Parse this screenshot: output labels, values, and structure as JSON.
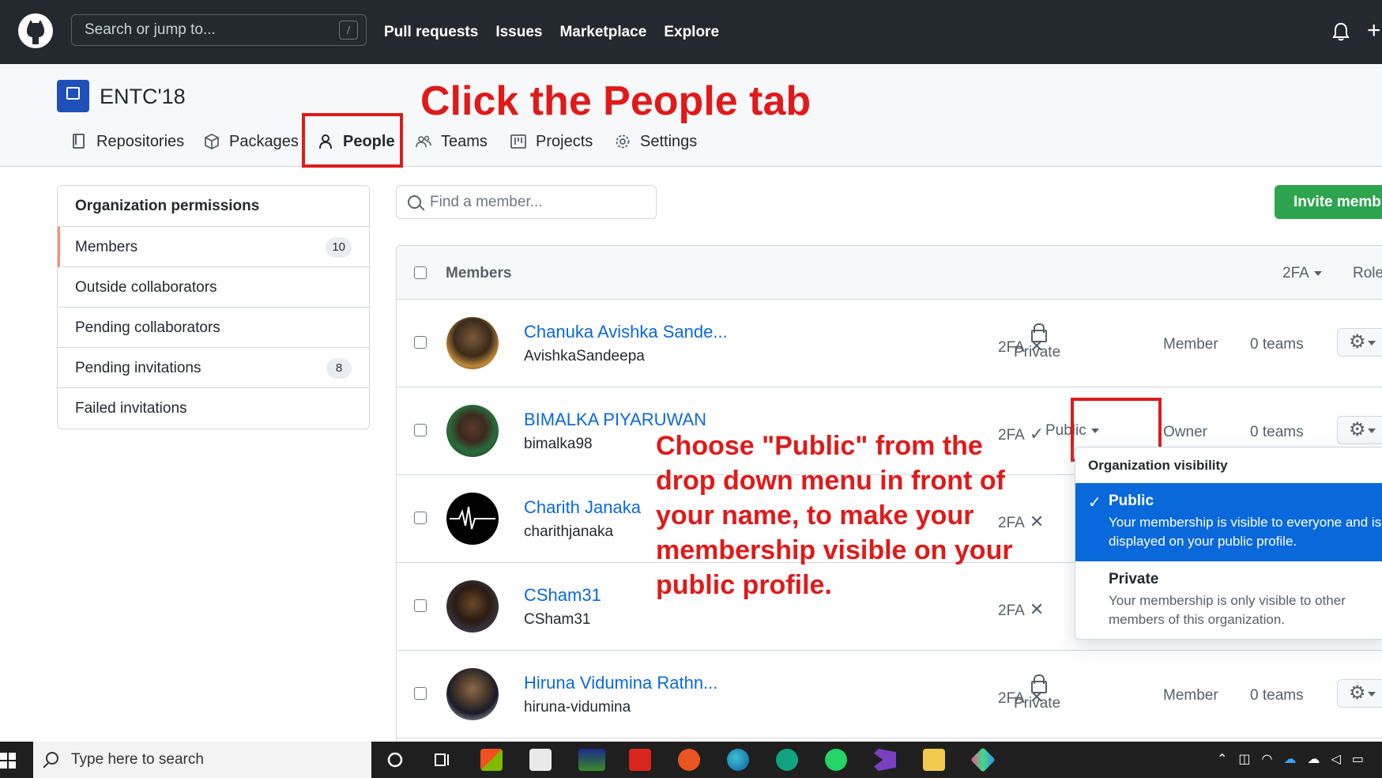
{
  "header": {
    "search_placeholder": "Search or jump to...",
    "search_shortcut": "/",
    "nav": [
      "Pull requests",
      "Issues",
      "Marketplace",
      "Explore"
    ],
    "plus": "+"
  },
  "org": {
    "name": "ENTC'18",
    "tabs": [
      "Repositories",
      "Packages",
      "People",
      "Teams",
      "Projects",
      "Settings"
    ],
    "active_tab": "People"
  },
  "annotations": {
    "title": "Click the People tab",
    "body": "Choose \"Public\" from the drop down menu in front of your name, to make your membership visible on your public profile.",
    "color": "#e01a1a"
  },
  "sidebar": {
    "heading": "Organization permissions",
    "items": [
      {
        "label": "Members",
        "count": "10"
      },
      {
        "label": "Outside collaborators",
        "count": ""
      },
      {
        "label": "Pending collaborators",
        "count": ""
      },
      {
        "label": "Pending invitations",
        "count": "8"
      },
      {
        "label": "Failed invitations",
        "count": ""
      }
    ]
  },
  "search": {
    "placeholder": "Find a member..."
  },
  "invite_button": "Invite memb",
  "table": {
    "header": {
      "label": "Members",
      "twofa": "2FA",
      "role": "Role"
    },
    "rows": [
      {
        "name": "Chanuka Avishka Sande...",
        "login": "AvishkaSandeepa",
        "twofa": "2FA",
        "twofa_mark": "✕",
        "visibility": "Private",
        "role": "Member",
        "teams": "0 teams"
      },
      {
        "name": "BIMALKA PIYARUWAN",
        "login": "bimalka98",
        "twofa": "2FA",
        "twofa_mark": "✓",
        "visibility": "Public",
        "role": "Owner",
        "teams": "0 teams"
      },
      {
        "name": "Charith Janaka",
        "login": "charithjanaka",
        "twofa": "2FA",
        "twofa_mark": "✕",
        "visibility": "",
        "role": "",
        "teams": ""
      },
      {
        "name": "CSham31",
        "login": "CSham31",
        "twofa": "2FA",
        "twofa_mark": "✕",
        "visibility": "",
        "role": "",
        "teams": ""
      },
      {
        "name": "Hiruna Vidumina Rathn...",
        "login": "hiruna-vidumina",
        "twofa": "2FA",
        "twofa_mark": "✕",
        "visibility": "Private",
        "role": "Member",
        "teams": "0 teams"
      }
    ]
  },
  "visibility_menu": {
    "heading": "Organization visibility",
    "options": [
      {
        "title": "Public",
        "description": "Your membership is visible to everyone and is displayed on your public profile.",
        "selected": true
      },
      {
        "title": "Private",
        "description": "Your membership is only visible to other members of this organization.",
        "selected": false
      }
    ]
  },
  "taskbar": {
    "search_placeholder": "Type here to search"
  }
}
